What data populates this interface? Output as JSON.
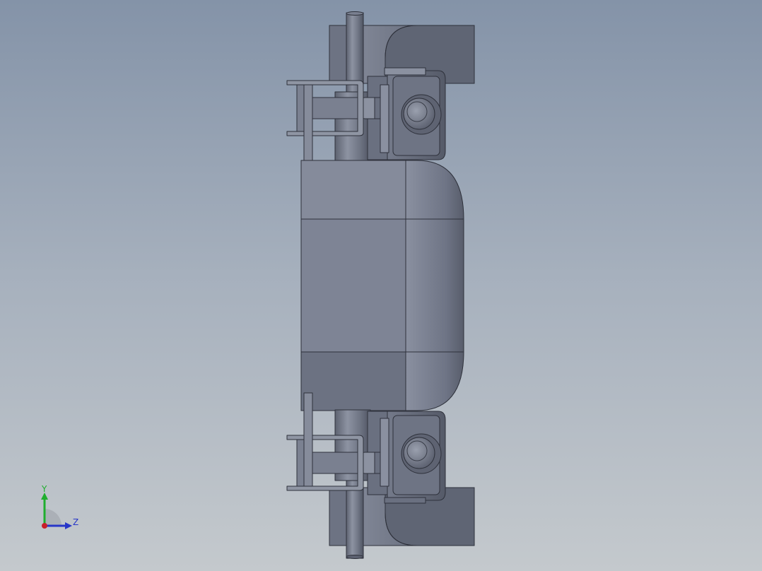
{
  "viewport": {
    "background_top": "#8493a8",
    "background_bottom": "#c4c9cd",
    "part_color": "#7d8496",
    "edge_color": "#2e313b"
  },
  "triad": {
    "y_label": "Y",
    "z_label": "Z",
    "y_color": "#1fae2e",
    "z_color": "#2736c8",
    "x_color": "#c8202a"
  }
}
